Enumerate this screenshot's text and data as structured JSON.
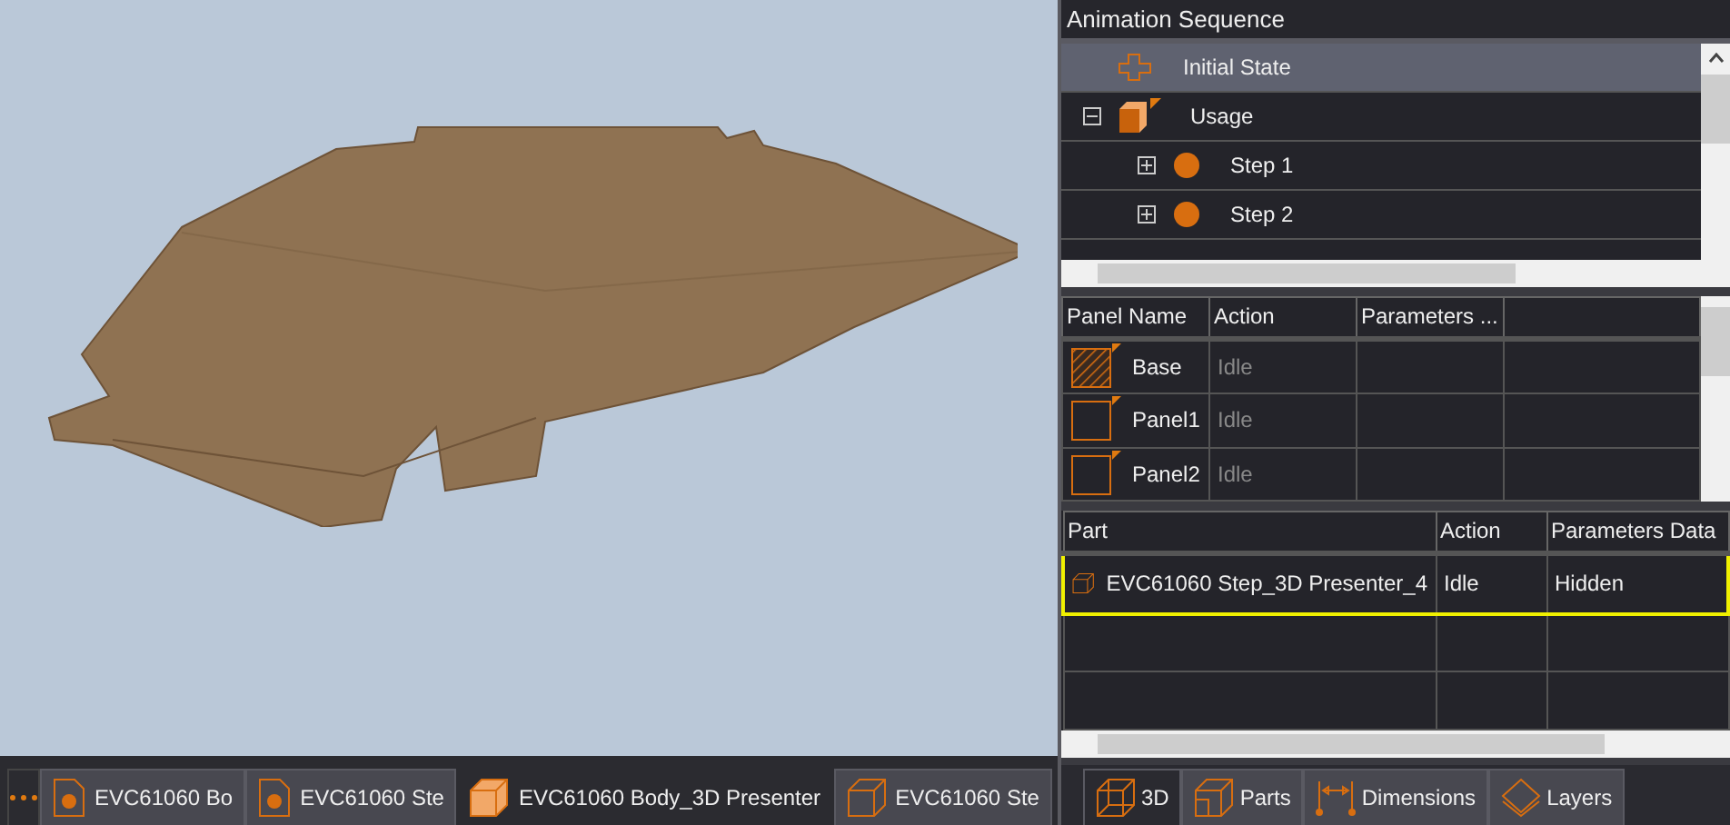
{
  "viewport": {
    "doc_tabs": [
      {
        "label": "EVC61060 Bo",
        "kind": "doc",
        "selected": false
      },
      {
        "label": "EVC61060 Ste",
        "kind": "doc",
        "selected": false
      },
      {
        "label": "EVC61060 Body_3D Presenter",
        "kind": "solid",
        "selected": true
      },
      {
        "label": "EVC61060 Ste",
        "kind": "wire",
        "selected": false
      }
    ]
  },
  "animation_sequence": {
    "title": "Animation Sequence",
    "items": [
      {
        "label": "Initial State",
        "kind": "initial",
        "selected": true
      },
      {
        "label": "Usage",
        "kind": "usage",
        "selected": false,
        "expanded": true,
        "children": [
          {
            "label": "Step 1",
            "kind": "step",
            "selected": false,
            "expanded": false
          },
          {
            "label": "Step 2",
            "kind": "step",
            "selected": false,
            "expanded": false
          }
        ]
      }
    ]
  },
  "panels_table": {
    "columns": [
      "Panel Name",
      "Action",
      "Parameters ..."
    ],
    "rows": [
      {
        "name": "Base",
        "kind": "base",
        "action": "Idle"
      },
      {
        "name": "Panel1",
        "kind": "panel",
        "action": "Idle"
      },
      {
        "name": "Panel2",
        "kind": "panel",
        "action": "Idle"
      }
    ]
  },
  "parts_table": {
    "columns": [
      "Part",
      "Action",
      "Parameters Data"
    ],
    "rows": [
      {
        "part": "EVC61060 Step_3D Presenter_4",
        "action": "Idle",
        "parameters": "Hidden",
        "highlighted": true
      }
    ]
  },
  "view_tabs": [
    {
      "label": "3D",
      "kind": "wireframe",
      "selected": true
    },
    {
      "label": "Parts",
      "kind": "parts",
      "selected": false
    },
    {
      "label": "Dimensions",
      "kind": "dimensions",
      "selected": false
    },
    {
      "label": "Layers",
      "kind": "layers",
      "selected": false
    }
  ]
}
